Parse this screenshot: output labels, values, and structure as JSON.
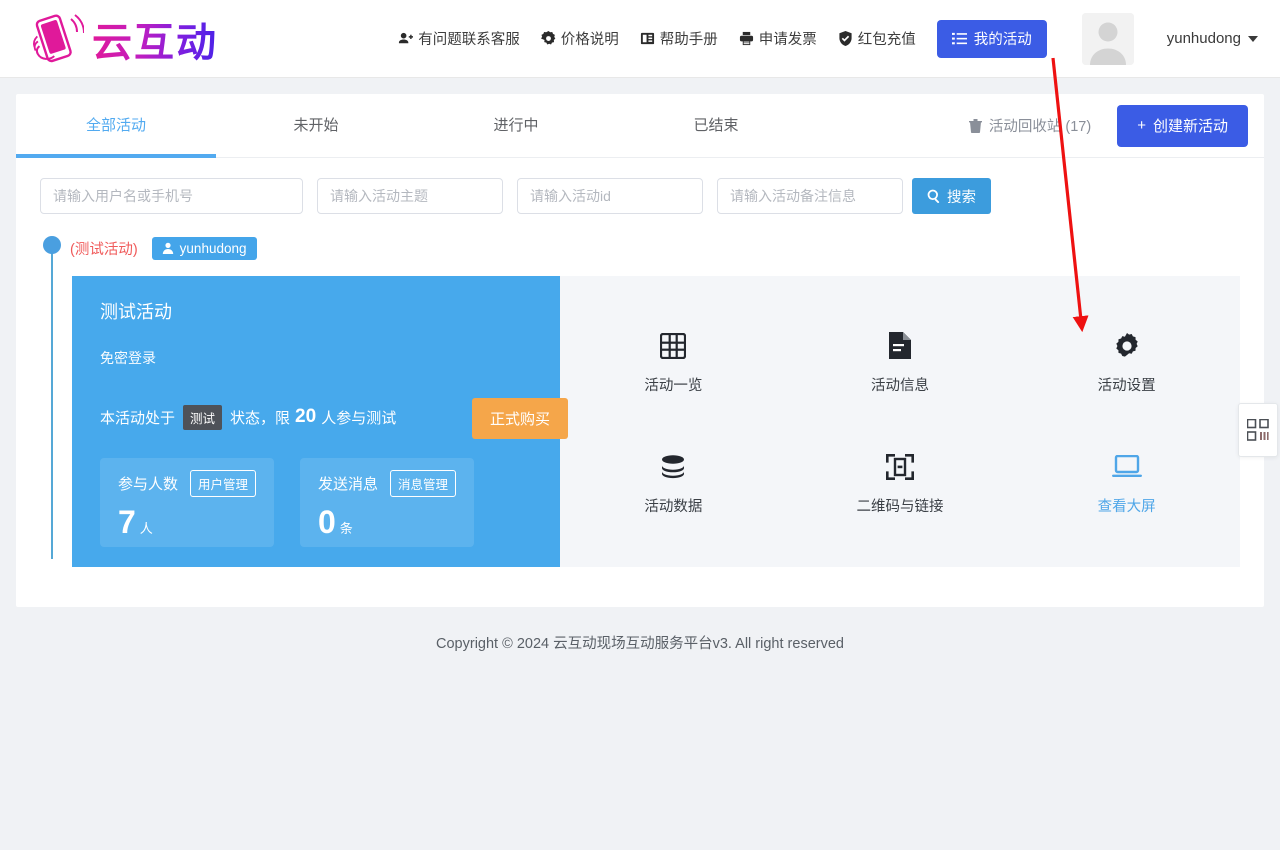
{
  "header": {
    "logo_text": "云互动",
    "logo_icon": "phone-hand-icon",
    "nav": [
      {
        "label": "有问题联系客服",
        "icon": "user-support-icon"
      },
      {
        "label": "价格说明",
        "icon": "price-tag-icon"
      },
      {
        "label": "帮助手册",
        "icon": "book-icon"
      },
      {
        "label": "申请发票",
        "icon": "printer-icon"
      },
      {
        "label": "红包充值",
        "icon": "shield-check-icon"
      }
    ],
    "my_activity_button": {
      "label": "我的活动",
      "icon": "list-icon",
      "color": "#3b5ce5"
    },
    "avatar_icon": "default-user-avatar",
    "username": "yunhudong",
    "caret_icon": "chevron-down-icon"
  },
  "tabs": [
    {
      "label": "全部活动",
      "active": true
    },
    {
      "label": "未开始",
      "active": false
    },
    {
      "label": "进行中",
      "active": false
    },
    {
      "label": "已结束",
      "active": false
    }
  ],
  "recycle": {
    "label": "活动回收站 (17)",
    "icon": "trash-icon"
  },
  "create_button": {
    "label": "创建新活动",
    "plus": "+",
    "color": "#3b5ce5"
  },
  "search": {
    "placeholders": [
      "请输入用户名或手机号",
      "请输入活动主题",
      "请输入活动id",
      "请输入活动备注信息"
    ],
    "values": [
      "",
      "",
      "",
      ""
    ],
    "button_label": "搜索",
    "button_icon": "search-icon",
    "button_color": "#3c9cdd"
  },
  "activity": {
    "dot_icon": "timeline-dot",
    "test_tag": "(测试活动)",
    "owner_badge": {
      "label": "yunhudong",
      "icon": "person-icon"
    },
    "card": {
      "title": "测试活动",
      "subtitle": "免密登录",
      "status_prefix": "本活动处于",
      "status_badge": "测试",
      "status_mid": "状态，限",
      "status_number": "20",
      "status_suffix": "人参与测试",
      "buy_button": {
        "label": "正式购买",
        "color": "#f5a64a"
      },
      "stats": [
        {
          "label": "参与人数",
          "manage_label": "用户管理",
          "value": "7",
          "unit": "人"
        },
        {
          "label": "发送消息",
          "manage_label": "消息管理",
          "value": "0",
          "unit": "条"
        }
      ]
    },
    "tools": [
      {
        "label": "活动一览",
        "icon": "grid-icon",
        "highlight": false
      },
      {
        "label": "活动信息",
        "icon": "document-icon",
        "highlight": false
      },
      {
        "label": "活动设置",
        "icon": "gear-icon",
        "highlight": false
      },
      {
        "label": "活动数据",
        "icon": "database-icon",
        "highlight": false
      },
      {
        "label": "二维码与链接",
        "icon": "qr-scan-icon",
        "highlight": false
      },
      {
        "label": "查看大屏",
        "icon": "monitor-icon",
        "highlight": true
      }
    ]
  },
  "side_tab": {
    "icon": "qr-code-icon"
  },
  "footer": {
    "text": "Copyright © 2024 云互动现场互动服务平台v3. All right reserved"
  },
  "annotation": {
    "arrow_color": "#ee1111"
  }
}
